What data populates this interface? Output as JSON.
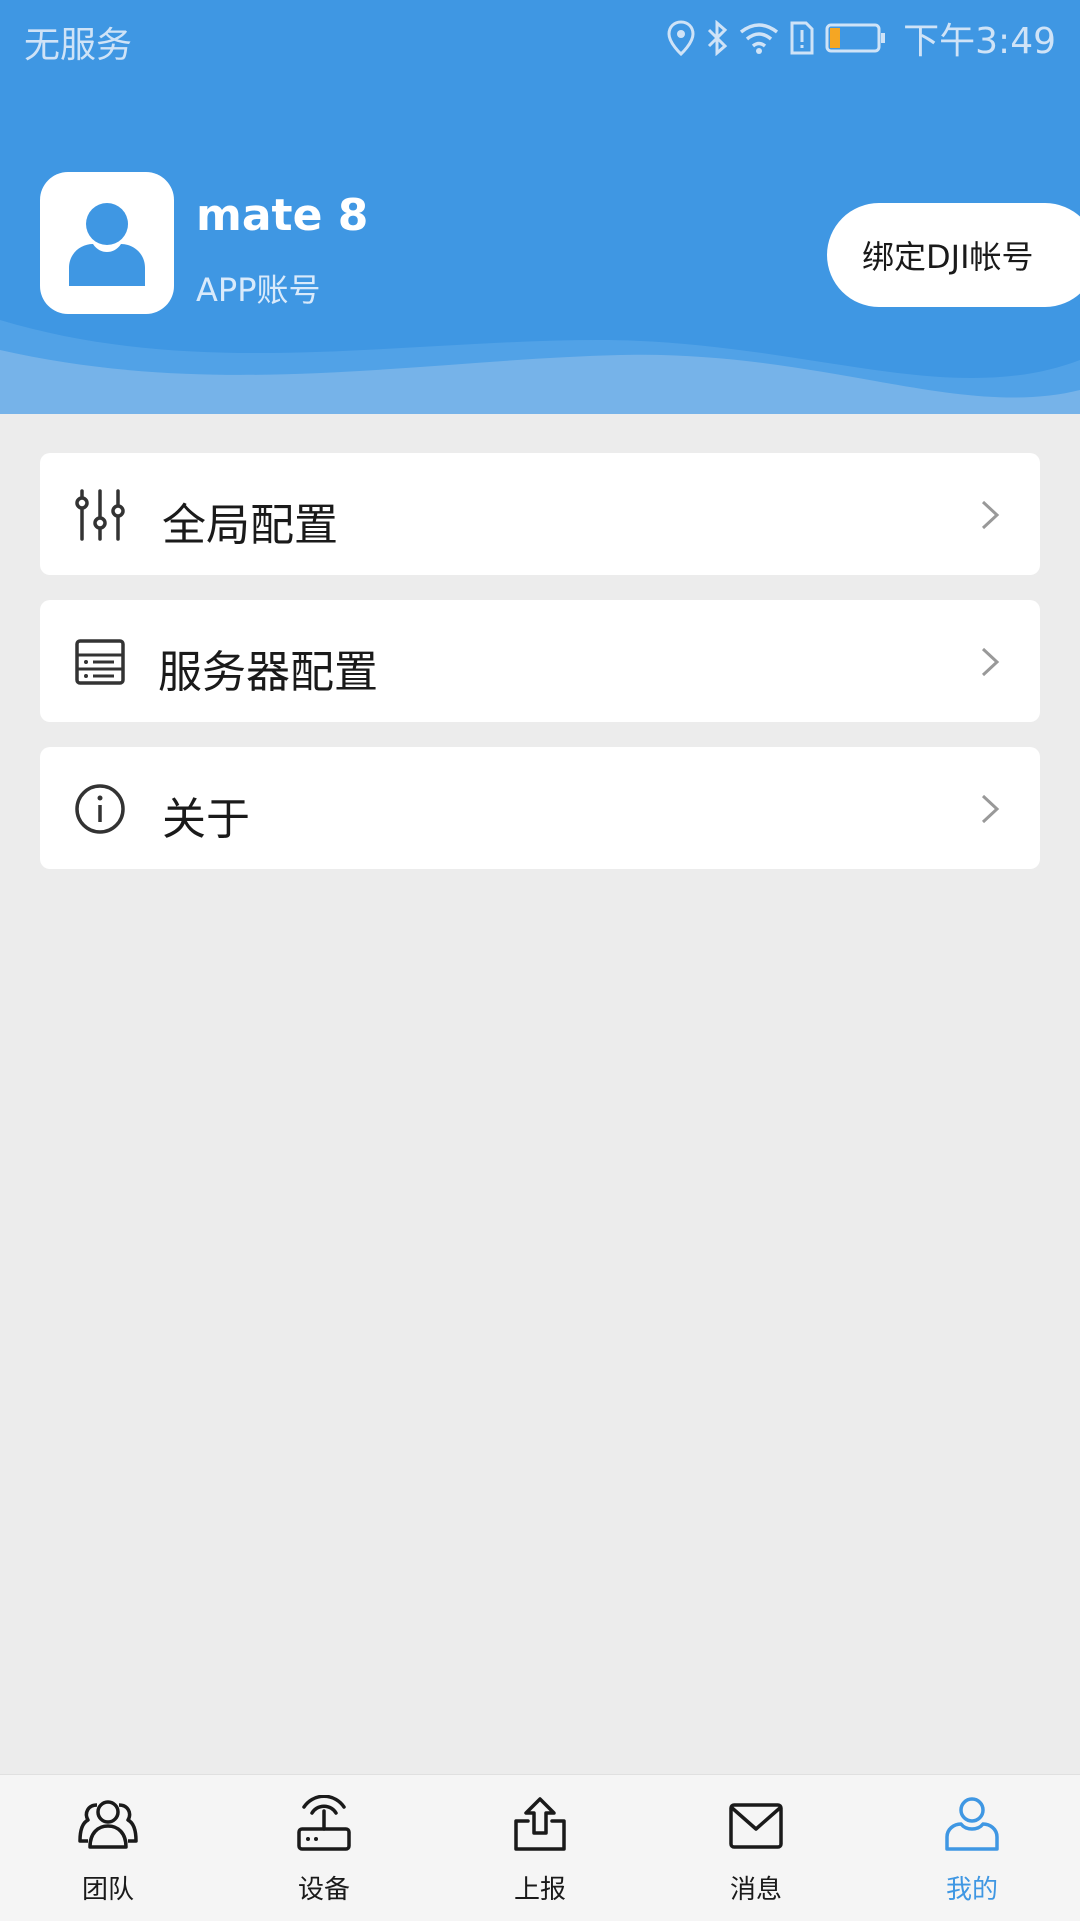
{
  "status_bar": {
    "carrier": "无服务",
    "time": "下午3:49",
    "icons": [
      "location-icon",
      "bluetooth-icon",
      "wifi-icon",
      "sim-icon",
      "battery-icon"
    ],
    "battery_color": "#f5a623"
  },
  "header": {
    "background_color": "#3f97e3",
    "username": "mate 8",
    "account_type": "APP账号",
    "bind_button_label": "绑定DJI帐号"
  },
  "menu": [
    {
      "label": "全局配置",
      "icon": "sliders-icon"
    },
    {
      "label": "服务器配置",
      "icon": "server-icon"
    },
    {
      "label": "关于",
      "icon": "info-icon"
    }
  ],
  "bottom_nav": {
    "items": [
      {
        "label": "团队",
        "icon": "team-icon"
      },
      {
        "label": "设备",
        "icon": "device-icon"
      },
      {
        "label": "上报",
        "icon": "upload-icon"
      },
      {
        "label": "消息",
        "icon": "mail-icon"
      },
      {
        "label": "我的",
        "icon": "user-icon"
      }
    ],
    "active_index": 4,
    "active_color": "#3f97e3"
  }
}
